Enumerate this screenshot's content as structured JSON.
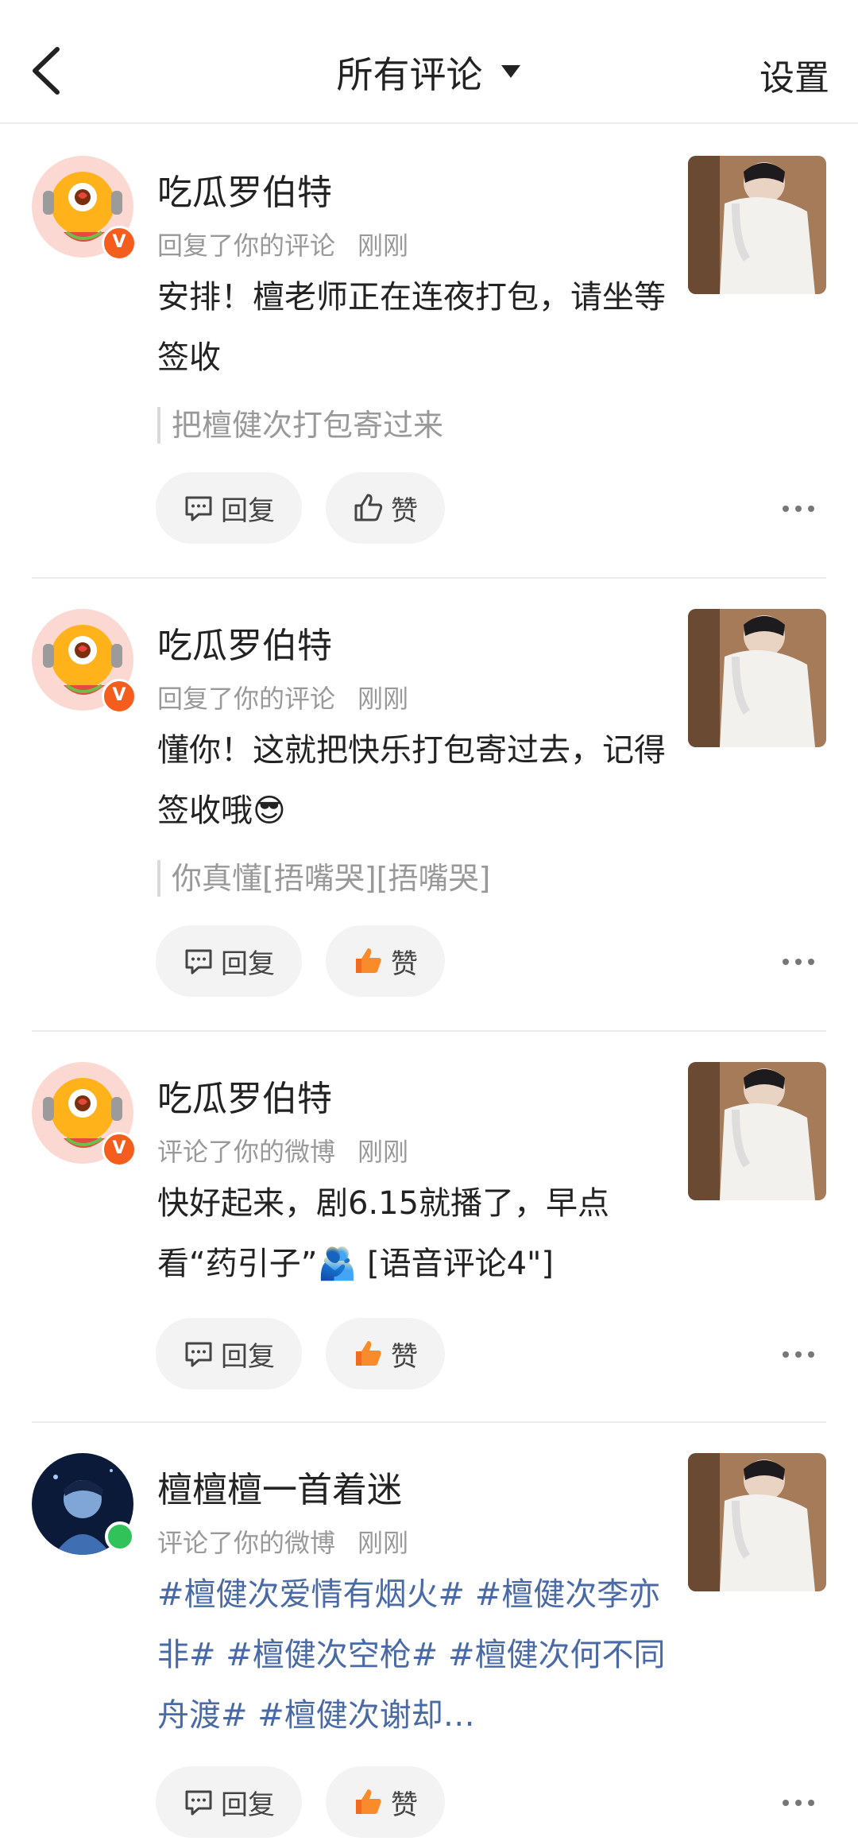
{
  "header": {
    "title": "所有评论",
    "settings_label": "设置"
  },
  "actions": {
    "reply_label": "回复",
    "like_label": "赞"
  },
  "comments": [
    {
      "username": "吃瓜罗伯特",
      "action": "回复了你的评论",
      "time": "刚刚",
      "content": "安排！檀老师正在连夜打包，请坐等签收",
      "quote": "把檀健次打包寄过来",
      "liked": false
    },
    {
      "username": "吃瓜罗伯特",
      "action": "回复了你的评论",
      "time": "刚刚",
      "content": "懂你！这就把快乐打包寄过去，记得签收哦😎",
      "quote": "你真懂[捂嘴哭][捂嘴哭]",
      "liked": true
    },
    {
      "username": "吃瓜罗伯特",
      "action": "评论了你的微博",
      "time": "刚刚",
      "content": "快好起来，剧6.15就播了，早点看“药引子”🫂 [语音评论4\"]",
      "liked": true
    },
    {
      "username": "檀檀檀一首着迷",
      "action": "评论了你的微博",
      "time": "刚刚",
      "content": "#檀健次爱情有烟火# #檀健次李亦非# #檀健次空枪# #檀健次何不同舟渡# #檀健次谢却…",
      "liked": true
    }
  ],
  "colors": {
    "accent": "#f45d1c",
    "hashtag": "#4a6aa5",
    "secondary_text": "#999999"
  }
}
